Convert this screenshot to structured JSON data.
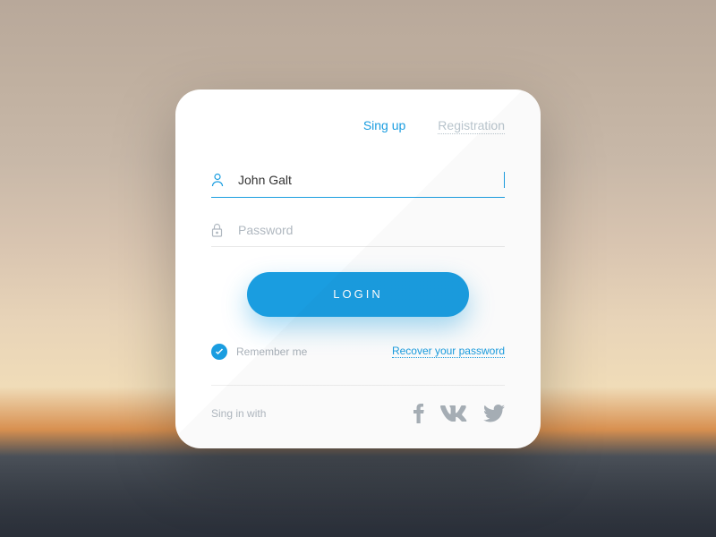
{
  "tabs": {
    "signup": "Sing up",
    "registration": "Registration"
  },
  "form": {
    "username_value": "John Galt",
    "password_placeholder": "Password"
  },
  "login_button": "LOGIN",
  "remember_label": "Remember me",
  "recover_label": "Recover your password",
  "social_label": "Sing in with"
}
